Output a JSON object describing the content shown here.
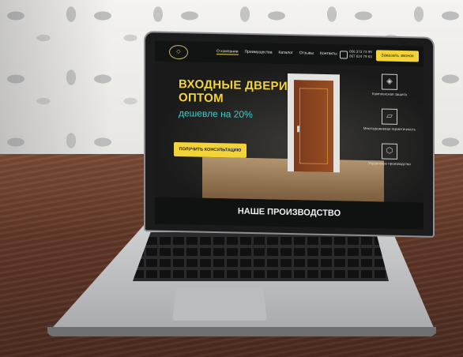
{
  "site": {
    "logo_text": "◇",
    "nav": {
      "items": [
        "О компании",
        "Преимущества",
        "Каталог",
        "Отзывы",
        "Контакты"
      ],
      "phones": [
        "066 373 73 99",
        "067 624 79 63"
      ],
      "call_button": "Заказать звонок"
    },
    "hero": {
      "title_line1": "ВХОДНЫЕ ДВЕРИ",
      "title_line2": "ОПТОМ",
      "subtitle": "дешевле на 20%",
      "cta": "ПОЛУЧИТЬ КОНСУЛЬТАЦИЮ"
    },
    "features": [
      {
        "icon": "cube-icon",
        "label": "Комплексная защита"
      },
      {
        "icon": "door-frame-icon",
        "label": "Многоуровневая герметичность"
      },
      {
        "icon": "ukraine-map-icon",
        "label": "Украинское производство"
      }
    ],
    "section_title": "НАШЕ ПРОИЗВОДСТВО"
  },
  "colors": {
    "accent_yellow": "#f2d338",
    "accent_teal": "#49c9c6",
    "background_dark": "#141617"
  }
}
